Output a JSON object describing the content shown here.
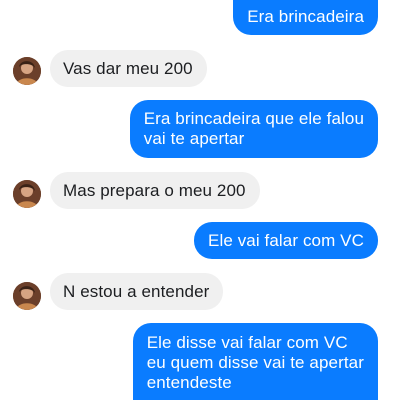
{
  "colors": {
    "sent_bubble": "#0a7cff",
    "received_bubble": "#f0f0f0",
    "sent_text": "#ffffff",
    "received_text": "#1c1e21"
  },
  "messages": [
    {
      "direction": "sent",
      "text": "Era brincadeira"
    },
    {
      "direction": "received",
      "avatar": "contact-avatar",
      "text": "Vas dar meu 200"
    },
    {
      "direction": "sent",
      "text": "Era brincadeira que ele falou\nvai te apertar"
    },
    {
      "direction": "received",
      "avatar": "contact-avatar",
      "text": "Mas prepara o meu 200"
    },
    {
      "direction": "sent",
      "text": "Ele vai falar com VC"
    },
    {
      "direction": "received",
      "avatar": "contact-avatar",
      "text": "N estou a entender"
    },
    {
      "direction": "sent",
      "text": "Ele disse vai falar com VC\neu quem disse vai te apertar\nentendeste"
    }
  ]
}
